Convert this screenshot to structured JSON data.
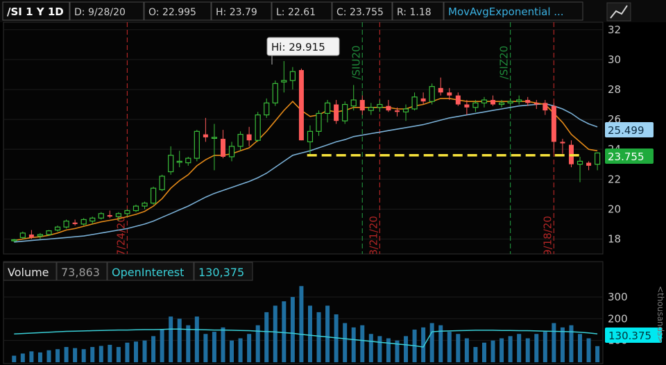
{
  "header": {
    "symbol": "/SI 1 Y 1D",
    "date": "D: 9/28/20",
    "open": "O: 22.995",
    "high": "H: 23.79",
    "low": "L: 22.61",
    "close": "C: 23.755",
    "range": "R: 1.18",
    "study": "MovAvgExponential ..."
  },
  "price_panel": {
    "hi_callout": "Hi: 29.915",
    "last_price_label": "23.755",
    "ema_slow_label": "25.499",
    "date_markers": [
      {
        "label": "7/24/20",
        "type": "red-dashed"
      },
      {
        "label": "/SIU20",
        "type": "green-dashed"
      },
      {
        "label": "8/21/20",
        "type": "red-dashed"
      },
      {
        "label": "/SIZ20",
        "type": "green-dashed"
      },
      {
        "label": "9/18/20",
        "type": "red-dashed"
      }
    ],
    "support_line_value": 23.6,
    "colors": {
      "up": "#3bbf3b",
      "down": "#ff5a5a",
      "ema_fast": "#e58a18",
      "ema_slow": "#7ab0d6",
      "support": "#f5e13a",
      "last_price_bg": "#1faa3c",
      "ema_slow_bg": "#9dd3f3"
    }
  },
  "volume_panel": {
    "title": "Volume",
    "volume_value": "73,863",
    "oi_label": "OpenInterest",
    "oi_value": "130,375",
    "oi_tag": "130.375",
    "unit_label": "<thousands>"
  },
  "chart_data": [
    {
      "type": "candlestick",
      "ylim": [
        17,
        32.5
      ],
      "yticks": [
        18,
        20,
        22,
        24,
        26,
        28,
        30,
        32
      ],
      "candles": [
        [
          17.9,
          18.0,
          17.8,
          17.95
        ],
        [
          18.1,
          18.5,
          18.0,
          18.4
        ],
        [
          18.3,
          18.6,
          18.0,
          18.1
        ],
        [
          18.2,
          18.4,
          18.0,
          18.3
        ],
        [
          18.3,
          18.6,
          18.2,
          18.55
        ],
        [
          18.6,
          18.9,
          18.5,
          18.8
        ],
        [
          18.8,
          19.3,
          18.7,
          19.2
        ],
        [
          19.1,
          19.3,
          18.9,
          19.0
        ],
        [
          19.0,
          19.4,
          18.9,
          19.3
        ],
        [
          19.2,
          19.5,
          19.0,
          19.4
        ],
        [
          19.4,
          19.8,
          19.3,
          19.7
        ],
        [
          19.6,
          19.9,
          19.4,
          19.5
        ],
        [
          19.5,
          19.8,
          19.2,
          19.7
        ],
        [
          19.7,
          20.0,
          19.5,
          19.9
        ],
        [
          19.9,
          20.3,
          19.8,
          20.2
        ],
        [
          20.2,
          20.5,
          20.0,
          20.4
        ],
        [
          20.4,
          21.5,
          20.3,
          21.4
        ],
        [
          21.3,
          22.3,
          21.2,
          22.2
        ],
        [
          22.5,
          24.2,
          22.3,
          23.6
        ],
        [
          23.2,
          23.9,
          22.8,
          23.2
        ],
        [
          23.1,
          23.5,
          22.9,
          23.4
        ],
        [
          23.4,
          25.3,
          23.2,
          25.2
        ],
        [
          25.0,
          26.1,
          24.5,
          24.8
        ],
        [
          24.8,
          25.7,
          22.6,
          24.8
        ],
        [
          24.7,
          25.3,
          23.4,
          23.5
        ],
        [
          23.5,
          24.5,
          23.2,
          24.2
        ],
        [
          24.2,
          25.2,
          23.9,
          25.0
        ],
        [
          25.0,
          25.5,
          24.2,
          24.6
        ],
        [
          24.6,
          26.5,
          24.5,
          26.3
        ],
        [
          26.3,
          27.4,
          26.1,
          27.1
        ],
        [
          27.1,
          28.6,
          26.9,
          28.4
        ],
        [
          28.5,
          29.9,
          27.8,
          28.6
        ],
        [
          28.6,
          29.5,
          28.0,
          29.2
        ],
        [
          29.3,
          29.4,
          24.6,
          24.6
        ],
        [
          24.5,
          25.6,
          23.6,
          25.2
        ],
        [
          25.2,
          26.6,
          24.9,
          26.4
        ],
        [
          26.4,
          27.3,
          25.8,
          27.1
        ],
        [
          27.0,
          27.3,
          25.7,
          25.9
        ],
        [
          25.9,
          27.2,
          25.7,
          27.0
        ],
        [
          26.9,
          28.3,
          26.6,
          27.3
        ],
        [
          27.3,
          27.6,
          26.3,
          26.6
        ],
        [
          26.6,
          27.1,
          26.3,
          26.8
        ],
        [
          26.8,
          27.3,
          26.5,
          27.0
        ],
        [
          26.9,
          27.3,
          26.5,
          26.6
        ],
        [
          26.6,
          26.8,
          26.2,
          26.5
        ],
        [
          26.5,
          27.0,
          25.9,
          26.7
        ],
        [
          26.7,
          27.8,
          26.6,
          27.5
        ],
        [
          27.4,
          27.8,
          27.0,
          27.2
        ],
        [
          27.2,
          28.4,
          27.0,
          28.2
        ],
        [
          28.1,
          28.8,
          27.6,
          27.8
        ],
        [
          27.8,
          28.1,
          27.3,
          27.6
        ],
        [
          27.6,
          27.8,
          26.9,
          27.0
        ],
        [
          27.0,
          27.3,
          26.3,
          26.8
        ],
        [
          26.8,
          27.3,
          26.5,
          27.1
        ],
        [
          27.1,
          27.5,
          26.8,
          27.3
        ],
        [
          27.3,
          27.6,
          26.9,
          27.0
        ],
        [
          27.0,
          27.3,
          26.8,
          27.1
        ],
        [
          27.1,
          27.4,
          26.9,
          27.2
        ],
        [
          27.2,
          27.6,
          27.0,
          27.3
        ],
        [
          27.3,
          27.5,
          26.9,
          27.1
        ],
        [
          27.1,
          27.3,
          26.7,
          27.0
        ],
        [
          27.1,
          27.3,
          26.3,
          26.6
        ],
        [
          26.9,
          27.1,
          23.8,
          24.5
        ],
        [
          24.5,
          24.7,
          23.7,
          24.4
        ],
        [
          24.3,
          24.6,
          22.8,
          23.0
        ],
        [
          23.0,
          23.5,
          21.8,
          23.2
        ],
        [
          23.1,
          23.2,
          22.6,
          22.9
        ],
        [
          23.0,
          23.8,
          22.6,
          23.755
        ]
      ],
      "ema_fast": [
        17.9,
        18.0,
        18.1,
        18.15,
        18.25,
        18.4,
        18.6,
        18.7,
        18.85,
        19.0,
        19.15,
        19.25,
        19.35,
        19.5,
        19.65,
        19.85,
        20.2,
        20.7,
        21.4,
        21.9,
        22.3,
        22.9,
        23.3,
        23.6,
        23.6,
        23.7,
        23.9,
        24.1,
        24.6,
        25.2,
        25.9,
        26.6,
        27.2,
        26.6,
        26.2,
        26.3,
        26.6,
        26.5,
        26.6,
        26.8,
        26.8,
        26.8,
        26.8,
        26.8,
        26.7,
        26.7,
        26.9,
        27.0,
        27.2,
        27.4,
        27.4,
        27.3,
        27.2,
        27.2,
        27.2,
        27.2,
        27.2,
        27.2,
        27.2,
        27.2,
        27.1,
        27.0,
        26.4,
        25.8,
        25.0,
        24.5,
        24.0,
        23.9
      ],
      "ema_slow": [
        17.8,
        17.85,
        17.9,
        17.95,
        18.0,
        18.05,
        18.1,
        18.15,
        18.2,
        18.3,
        18.4,
        18.5,
        18.6,
        18.7,
        18.85,
        19.0,
        19.2,
        19.45,
        19.7,
        19.95,
        20.2,
        20.5,
        20.8,
        21.05,
        21.25,
        21.45,
        21.65,
        21.85,
        22.1,
        22.4,
        22.8,
        23.2,
        23.6,
        23.75,
        23.9,
        24.1,
        24.3,
        24.5,
        24.65,
        24.85,
        24.95,
        25.05,
        25.15,
        25.25,
        25.35,
        25.45,
        25.55,
        25.65,
        25.8,
        25.95,
        26.1,
        26.2,
        26.3,
        26.4,
        26.5,
        26.6,
        26.7,
        26.8,
        26.9,
        26.95,
        27.0,
        27.05,
        26.9,
        26.7,
        26.4,
        26.0,
        25.7,
        25.499
      ]
    },
    {
      "type": "bar",
      "ylim": [
        0,
        370
      ],
      "yticks": [
        100,
        200,
        300
      ],
      "volume": [
        30,
        40,
        50,
        45,
        55,
        60,
        70,
        65,
        60,
        70,
        75,
        80,
        70,
        90,
        95,
        100,
        120,
        150,
        210,
        200,
        170,
        210,
        130,
        140,
        160,
        100,
        110,
        130,
        170,
        230,
        260,
        280,
        300,
        350,
        260,
        230,
        260,
        220,
        180,
        160,
        170,
        130,
        120,
        110,
        100,
        120,
        150,
        160,
        180,
        170,
        140,
        130,
        110,
        70,
        90,
        100,
        110,
        120,
        130,
        110,
        130,
        140,
        180,
        160,
        170,
        130,
        110,
        74
      ],
      "open_interest": [
        130,
        132,
        134,
        136,
        138,
        140,
        142,
        143,
        144,
        145,
        146,
        147,
        148,
        148,
        149,
        150,
        150,
        151,
        152,
        152,
        151,
        150,
        149,
        148,
        148,
        147,
        146,
        145,
        143,
        141,
        139,
        136,
        133,
        128,
        124,
        120,
        116,
        112,
        108,
        104,
        100,
        96,
        92,
        88,
        84,
        80,
        76,
        70,
        140,
        143,
        144,
        145,
        146,
        147,
        147,
        147,
        146,
        146,
        145,
        145,
        144,
        143,
        142,
        141,
        140,
        138,
        135,
        130.375
      ]
    }
  ]
}
